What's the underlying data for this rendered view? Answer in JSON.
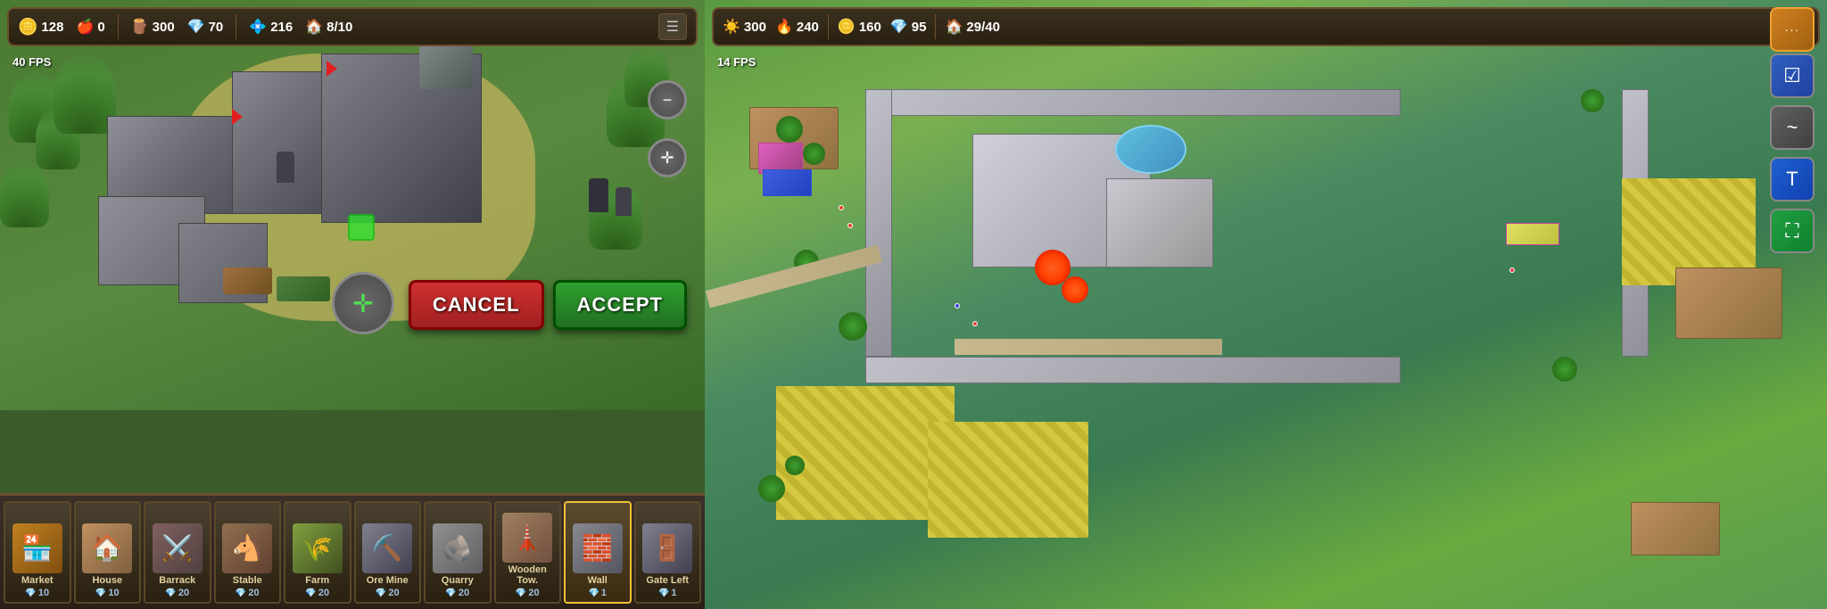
{
  "left": {
    "hud": {
      "gold_icon": "🪙",
      "gold_value": "128",
      "food_icon": "🍎",
      "food_value": "0",
      "wood_icon": "🪵",
      "wood_value": "300",
      "stone_icon": "💎",
      "stone_value": "70",
      "gem_icon": "💠",
      "gem_value": "216",
      "house_icon": "🏠",
      "house_value": "8/10",
      "menu_icon": "☰"
    },
    "fps": "40 FPS",
    "buttons": {
      "cancel": "CANCEL",
      "accept": "ACCEPT"
    },
    "buildings": [
      {
        "id": "market",
        "label": "Market",
        "cost": "10",
        "cost_icon": "💎"
      },
      {
        "id": "house",
        "label": "House",
        "cost": "10",
        "cost_icon": "💎"
      },
      {
        "id": "barrack",
        "label": "Barrack",
        "cost": "20",
        "cost_icon": "💎"
      },
      {
        "id": "stable",
        "label": "Stable",
        "cost": "20",
        "cost_icon": "💎"
      },
      {
        "id": "farm",
        "label": "Farm",
        "cost": "20",
        "cost_icon": "💎"
      },
      {
        "id": "oremine",
        "label": "Ore Mine",
        "cost": "20",
        "cost_icon": "💎"
      },
      {
        "id": "quarry",
        "label": "Quarry",
        "cost": "20",
        "cost_icon": "💎"
      },
      {
        "id": "woodtower",
        "label": "Wooden Tow.",
        "cost": "20",
        "cost_icon": "💎"
      },
      {
        "id": "wall",
        "label": "Wall",
        "cost": "1",
        "cost_icon": "💎"
      },
      {
        "id": "gateleft",
        "label": "Gate Left",
        "cost": "1",
        "cost_icon": "💎"
      }
    ]
  },
  "right": {
    "hud": {
      "sun_icon": "☀️",
      "sun_value": "300",
      "fire_icon": "🔥",
      "fire_value": "240",
      "coin_icon": "🪙",
      "coin_value": "160",
      "silver_icon": "💎",
      "silver_value": "95",
      "population_icon": "🏠",
      "population_value": "29/40"
    },
    "fps": "14 FPS",
    "action_buttons": [
      {
        "id": "checklist",
        "icon": "☑",
        "color": "blue"
      },
      {
        "id": "tilde",
        "icon": "~",
        "color": "gray"
      },
      {
        "id": "text",
        "icon": "T",
        "color": "blue2"
      },
      {
        "id": "expand",
        "icon": "⛶",
        "color": "green"
      }
    ],
    "notification": {
      "icon": "···"
    }
  }
}
